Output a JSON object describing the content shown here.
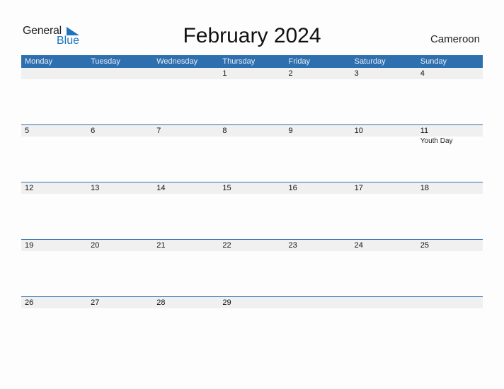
{
  "logo": {
    "general": "General",
    "blue": "Blue"
  },
  "title": "February 2024",
  "country": "Cameroon",
  "colors": {
    "accent": "#2e6fb0",
    "date_row_bg": "#f0f0f0"
  },
  "weekdays": [
    "Monday",
    "Tuesday",
    "Wednesday",
    "Thursday",
    "Friday",
    "Saturday",
    "Sunday"
  ],
  "weeks": [
    {
      "days": [
        "",
        "",
        "",
        "1",
        "2",
        "3",
        "4"
      ],
      "events": [
        "",
        "",
        "",
        "",
        "",
        "",
        ""
      ]
    },
    {
      "days": [
        "5",
        "6",
        "7",
        "8",
        "9",
        "10",
        "11"
      ],
      "events": [
        "",
        "",
        "",
        "",
        "",
        "",
        "Youth Day"
      ]
    },
    {
      "days": [
        "12",
        "13",
        "14",
        "15",
        "16",
        "17",
        "18"
      ],
      "events": [
        "",
        "",
        "",
        "",
        "",
        "",
        ""
      ]
    },
    {
      "days": [
        "19",
        "20",
        "21",
        "22",
        "23",
        "24",
        "25"
      ],
      "events": [
        "",
        "",
        "",
        "",
        "",
        "",
        ""
      ]
    },
    {
      "days": [
        "26",
        "27",
        "28",
        "29",
        "",
        "",
        ""
      ],
      "events": [
        "",
        "",
        "",
        "",
        "",
        "",
        ""
      ]
    }
  ]
}
